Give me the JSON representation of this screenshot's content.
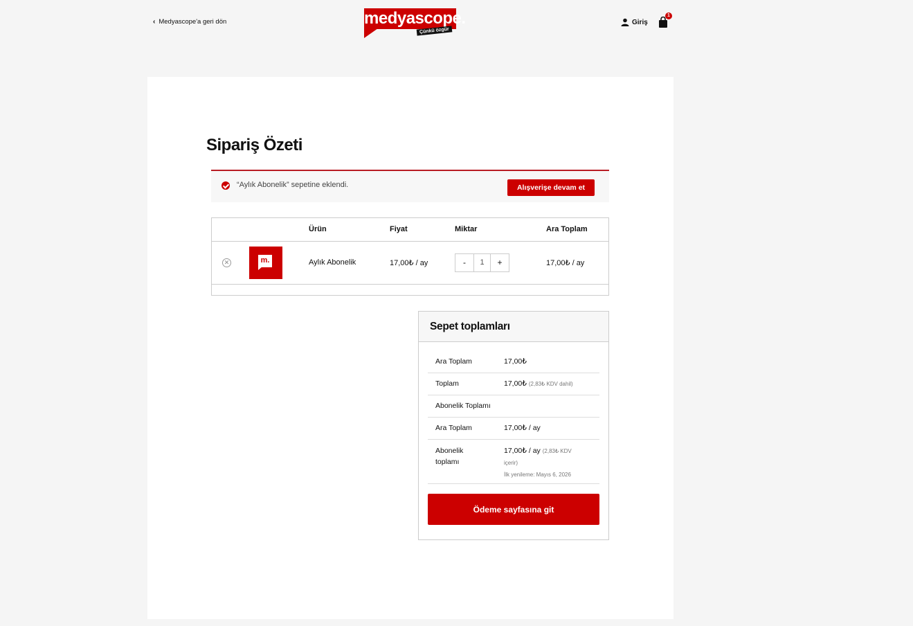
{
  "header": {
    "back_label": "Medyascope'a geri dön",
    "logo_text": "medyascope.",
    "logo_tagline": "Çünkü özgür",
    "login_label": "Giriş",
    "cart_count": "1"
  },
  "page": {
    "title": "Sipariş Özeti"
  },
  "notice": {
    "message": "“Aylık Abonelik” sepetine eklendi.",
    "continue_label": "Alışverişe devam et"
  },
  "cart_table": {
    "headers": {
      "product": "Ürün",
      "price": "Fiyat",
      "quantity": "Miktar",
      "subtotal": "Ara Toplam"
    },
    "items": [
      {
        "thumb_text": "m.",
        "name": "Aylık Abonelik",
        "price": "17,00₺ / ay",
        "qty_minus": "-",
        "qty": "1",
        "qty_plus": "+",
        "subtotal": "17,00₺ / ay"
      }
    ]
  },
  "totals": {
    "title": "Sepet toplamları",
    "subtotal_label": "Ara Toplam",
    "subtotal_value": "17,00₺",
    "total_label": "Toplam",
    "total_value": "17,00₺",
    "total_note": "(2,83₺ KDV dahil)",
    "subscription_heading": "Abonelik Toplamı",
    "recurring_subtotal_label": "Ara Toplam",
    "recurring_subtotal_value": "17,00₺ / ay",
    "recurring_total_label_1": "Abonelik",
    "recurring_total_label_2": "toplamı",
    "recurring_total_value": "17,00₺ / ay",
    "recurring_total_note_1": "(2,83₺ KDV",
    "recurring_total_note_2": "içerir)",
    "first_renewal": "İlk yenileme: Mayıs 6, 2026",
    "checkout_label": "Ödeme sayfasına git"
  },
  "colors": {
    "accent": "#cc0000",
    "notice_border": "#b81c23"
  }
}
